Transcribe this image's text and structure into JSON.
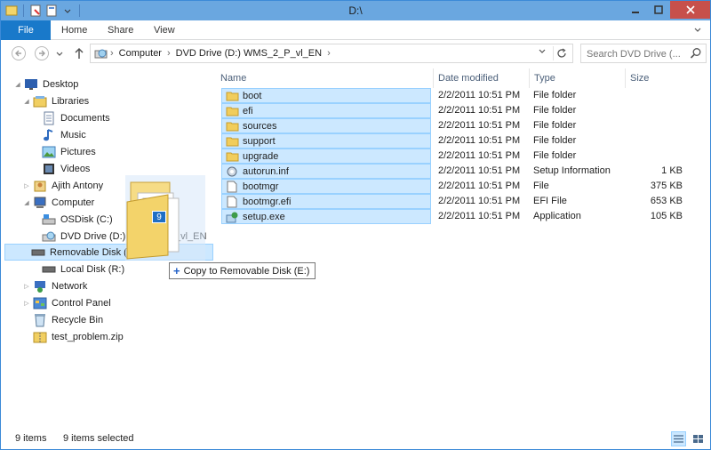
{
  "window": {
    "title": "D:\\",
    "accent": "#1979ca",
    "selection_color": "#cce8ff"
  },
  "ribbon": {
    "tabs": [
      "File",
      "Home",
      "Share",
      "View"
    ]
  },
  "address": {
    "crumbs": [
      "Computer",
      "DVD Drive (D:) WMS_2_P_vl_EN"
    ],
    "search_placeholder": "Search DVD Drive (..."
  },
  "nav": {
    "items": [
      {
        "label": "Desktop",
        "icon": "desktop-icon"
      },
      {
        "label": "Libraries",
        "icon": "libraries-icon"
      },
      {
        "label": "Documents",
        "icon": "documents-icon"
      },
      {
        "label": "Music",
        "icon": "music-icon"
      },
      {
        "label": "Pictures",
        "icon": "pictures-icon"
      },
      {
        "label": "Videos",
        "icon": "videos-icon"
      },
      {
        "label": "Ajith Antony",
        "icon": "user-icon"
      },
      {
        "label": "Computer",
        "icon": "computer-icon"
      },
      {
        "label": "OSDisk (C:)",
        "icon": "os-disk-icon"
      },
      {
        "label": "DVD Drive (D:) WMS_2_P_vl_EN",
        "icon": "dvd-drive-icon"
      },
      {
        "label": "Removable Disk (E:)",
        "icon": "removable-disk-icon"
      },
      {
        "label": "Local Disk (R:)",
        "icon": "local-disk-icon"
      },
      {
        "label": "Network",
        "icon": "network-icon"
      },
      {
        "label": "Control Panel",
        "icon": "control-panel-icon"
      },
      {
        "label": "Recycle Bin",
        "icon": "recycle-bin-icon"
      },
      {
        "label": "test_problem.zip",
        "icon": "zip-icon"
      }
    ]
  },
  "list": {
    "columns": [
      "Name",
      "Date modified",
      "Type",
      "Size"
    ],
    "rows": [
      {
        "name": "boot",
        "date": "2/2/2011 10:51 PM",
        "type": "File folder",
        "size": "",
        "icon": "folder-icon"
      },
      {
        "name": "efi",
        "date": "2/2/2011 10:51 PM",
        "type": "File folder",
        "size": "",
        "icon": "folder-icon"
      },
      {
        "name": "sources",
        "date": "2/2/2011 10:51 PM",
        "type": "File folder",
        "size": "",
        "icon": "folder-icon"
      },
      {
        "name": "support",
        "date": "2/2/2011 10:51 PM",
        "type": "File folder",
        "size": "",
        "icon": "folder-icon"
      },
      {
        "name": "upgrade",
        "date": "2/2/2011 10:51 PM",
        "type": "File folder",
        "size": "",
        "icon": "folder-icon"
      },
      {
        "name": "autorun.inf",
        "date": "2/2/2011 10:51 PM",
        "type": "Setup Information",
        "size": "1 KB",
        "icon": "setup-info-icon"
      },
      {
        "name": "bootmgr",
        "date": "2/2/2011 10:51 PM",
        "type": "File",
        "size": "375 KB",
        "icon": "file-icon"
      },
      {
        "name": "bootmgr.efi",
        "date": "2/2/2011 10:51 PM",
        "type": "EFI File",
        "size": "653 KB",
        "icon": "file-icon"
      },
      {
        "name": "setup.exe",
        "date": "2/2/2011 10:51 PM",
        "type": "Application",
        "size": "105 KB",
        "icon": "setup-exe-icon"
      }
    ]
  },
  "drag": {
    "count": "9",
    "tooltip": "Copy to Removable Disk (E:)"
  },
  "status": {
    "items": "9 items",
    "selected": "9 items selected"
  }
}
